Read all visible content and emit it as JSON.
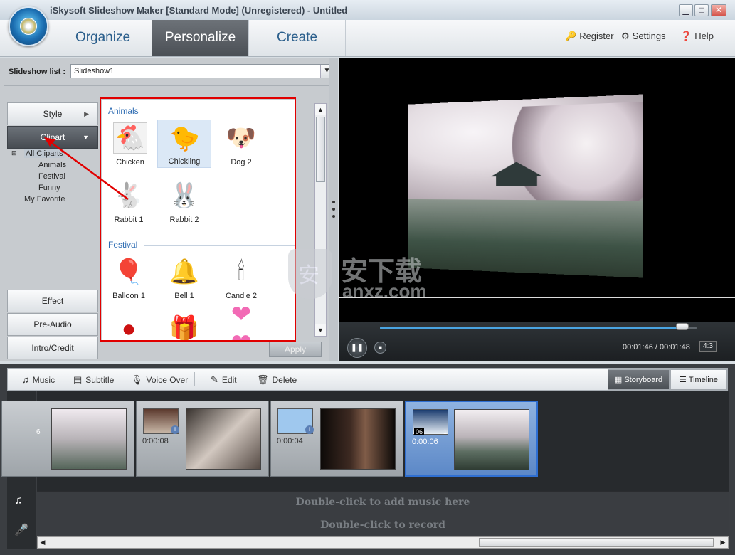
{
  "window": {
    "title": "iSkysoft Slideshow Maker [Standard Mode] (Unregistered) - Untitled",
    "min": "▁",
    "max": "□",
    "close": "✕"
  },
  "nav": {
    "tabs": [
      {
        "label": "Organize"
      },
      {
        "label": "Personalize"
      },
      {
        "label": "Create"
      }
    ],
    "active": "Personalize",
    "register": "Register",
    "settings": "Settings",
    "help": "Help"
  },
  "slideshow_list": {
    "label": "Slideshow list :",
    "value": "Slideshow1"
  },
  "categories": {
    "style": "Style",
    "clipart": "Clipart",
    "effect": "Effect",
    "pre_audio": "Pre-Audio",
    "intro_credit": "Intro/Credit"
  },
  "tree": {
    "all": "All Cliparts",
    "animals": "Animals",
    "festival": "Festival",
    "funny": "Funny",
    "favorite": "My Favorite"
  },
  "clipart": {
    "animals_title": "Animals",
    "festival_title": "Festival",
    "animals": [
      "Chicken",
      "Chickling",
      "Dog 2",
      "Rabbit 1",
      "Rabbit 2"
    ],
    "festival": [
      "Balloon 1",
      "Bell 1",
      "Candle 2"
    ]
  },
  "apply_label": "Apply",
  "player": {
    "time": "00:01:46 / 00:01:48",
    "ratio": "4:3",
    "progress": 0.96
  },
  "toolbar": {
    "music": "Music",
    "subtitle": "Subtitle",
    "voiceover": "Voice Over",
    "edit": "Edit",
    "delete": "Delete",
    "storyboard": "Storyboard",
    "timeline": "Timeline"
  },
  "storyboard": [
    {
      "duration": "0:00:08"
    },
    {
      "duration": "0:00:04"
    },
    {
      "duration": "0:00:06"
    }
  ],
  "first_frame_num": "6",
  "selected_frame_index": "06",
  "selected_frame_badge": "1",
  "hints": {
    "music": "Double-click to add music here",
    "record": "Double-click to record"
  },
  "watermark": {
    "big": "安下载",
    "small": "anxz.com",
    "shield": "安"
  }
}
